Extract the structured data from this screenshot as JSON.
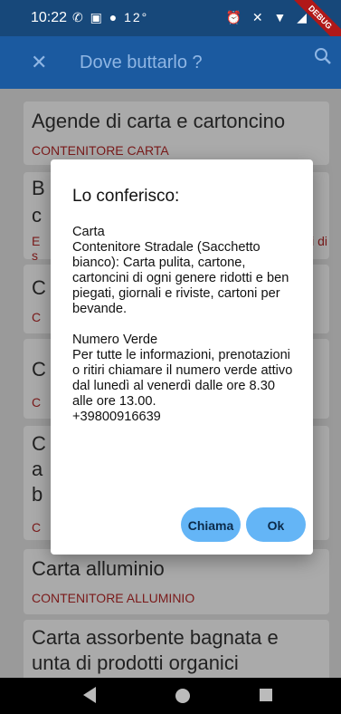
{
  "status": {
    "time": "10:22",
    "icons_left": "✆ ▣ ● 12°",
    "icons_right": "⏰ ✕ ▼ ◢",
    "debug_banner": "DEBUG"
  },
  "appbar": {
    "title": "Dove buttarlo ?"
  },
  "items": [
    {
      "name": "Agende di carta e cartoncino",
      "category": "CONTENITORE CARTA"
    },
    {
      "name": "B",
      "name2": "c",
      "category": "E",
      "category_tail": "li di",
      "category2": "s"
    },
    {
      "name": "C",
      "category": "C"
    },
    {
      "name": "C",
      "category": "C"
    },
    {
      "name": "C",
      "name2": "a",
      "name3": "b",
      "category": "C"
    },
    {
      "name": "Carta alluminio",
      "category": "CONTENITORE ALLUMINIO"
    },
    {
      "name": "Carta assorbente bagnata e",
      "name2": "unta di prodotti organici"
    }
  ],
  "dialog": {
    "title": "Lo conferisco:",
    "body": "Carta\nContenitore Stradale (Sacchetto bianco): Carta pulita, cartone, cartoncini di ogni genere ridotti e ben piegati, giornali e riviste, cartoni per bevande.\n\nNumero Verde\nPer tutte le informazioni, prenotazioni o ritiri chiamare il numero verde attivo dal lunedì al venerdì dalle ore 8.30 alle ore 13.00.\n+39800916639",
    "call_label": "Chiama",
    "ok_label": "Ok"
  }
}
